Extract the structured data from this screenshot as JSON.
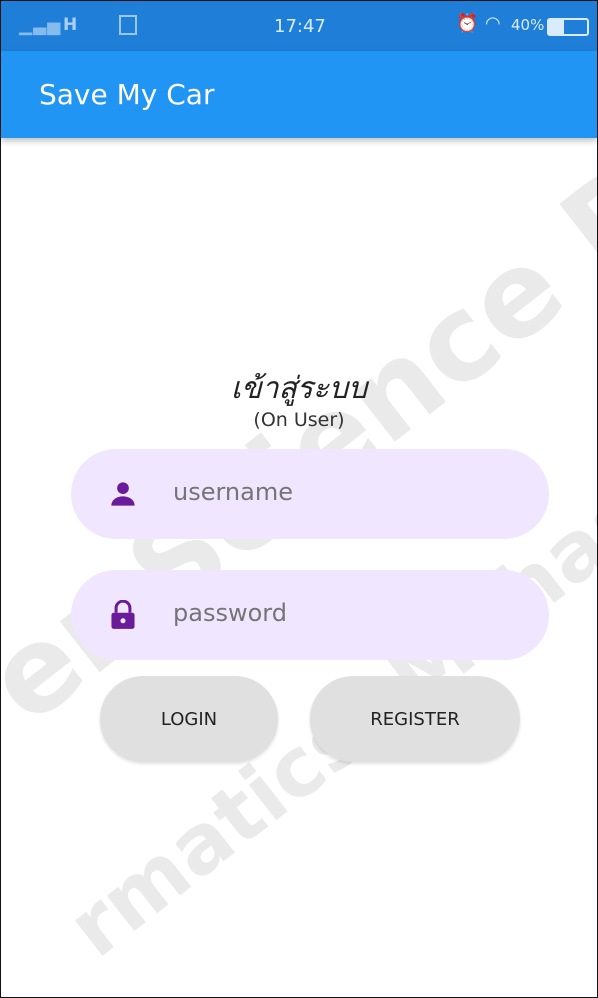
{
  "status_bar": {
    "network": "H",
    "time": "17:47",
    "battery_text": "40%",
    "battery_level": 0.4,
    "icons": [
      "signal-icon",
      "sim-icon",
      "alarm-icon",
      "wifi-icon",
      "battery-icon"
    ]
  },
  "app_bar": {
    "title": "Save My Car",
    "color": "#2195f3"
  },
  "login": {
    "title": "เข้าสู่ระบบ",
    "subtitle": "(On User)",
    "username_placeholder": "username",
    "password_placeholder": "password",
    "login_label": "LOGIN",
    "register_label": "REGISTER"
  },
  "colors": {
    "field_bg": "#f0e6ff",
    "icon": "#6a1b9a",
    "button_bg": "#e0e0e0"
  },
  "watermark": {
    "line1": "er Science Departm",
    "line2": "rmatics, Mahasarakham"
  }
}
